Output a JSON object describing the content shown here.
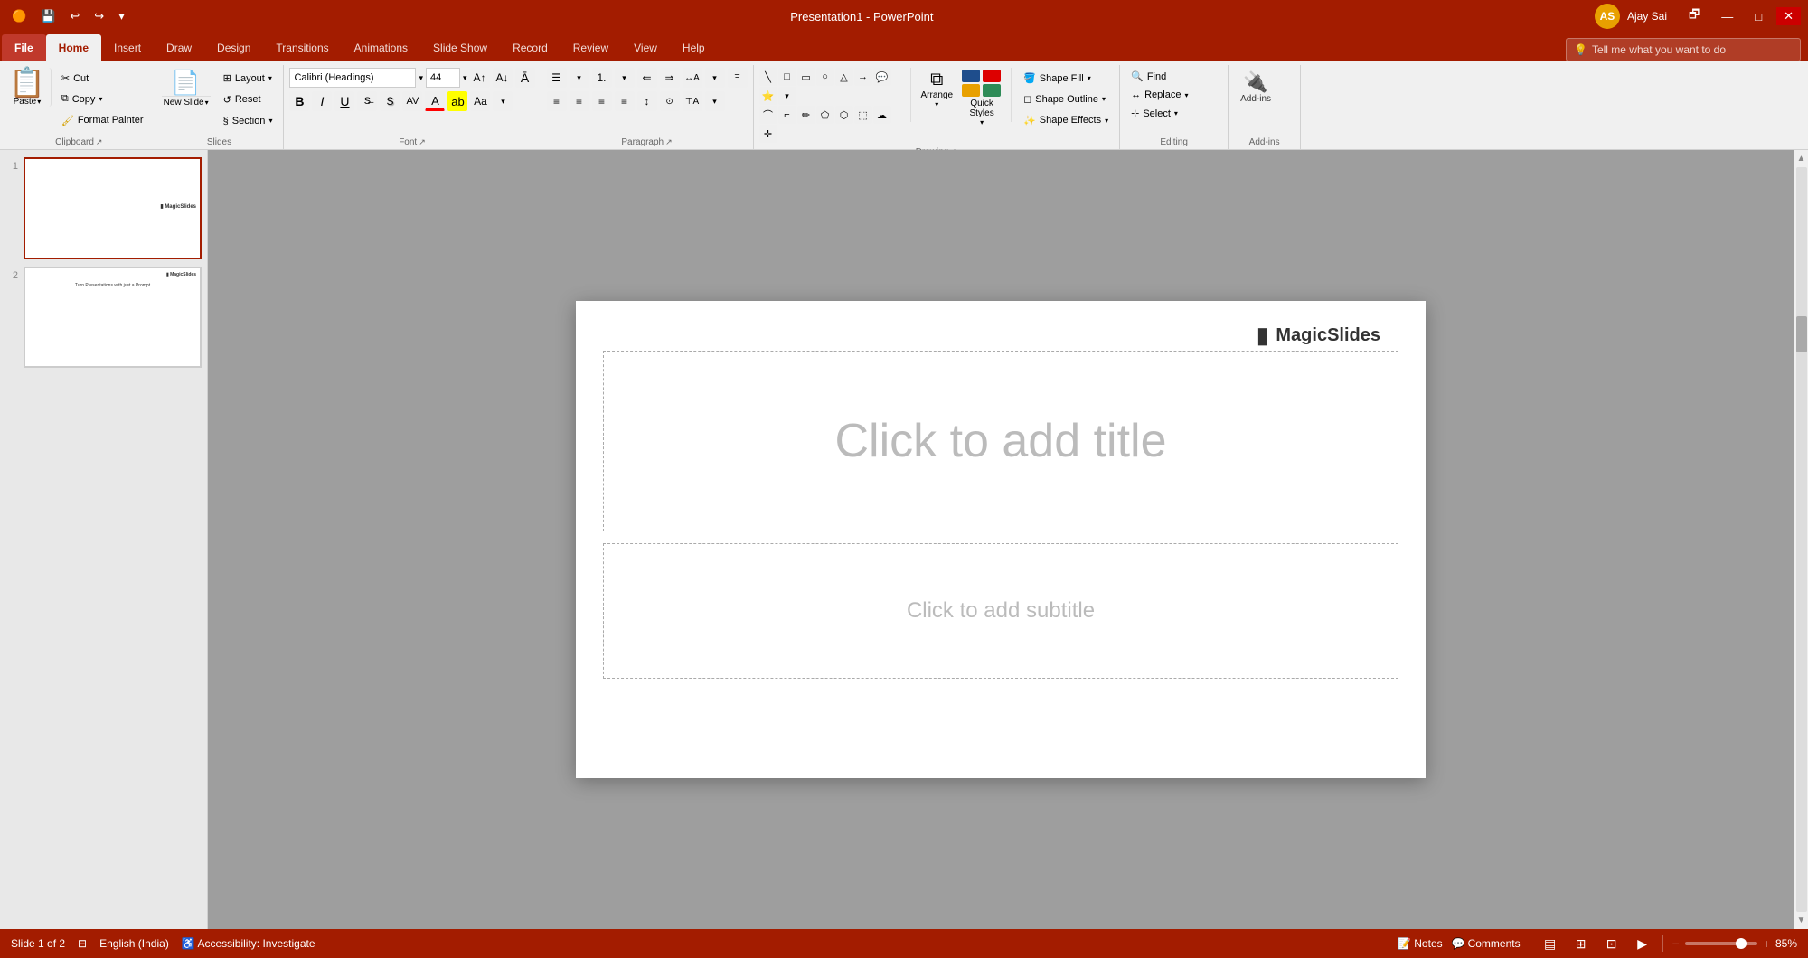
{
  "title_bar": {
    "title": "Presentation1  -  PowerPoint",
    "user": "Ajay Sai",
    "user_initials": "AS",
    "qat": [
      "save",
      "undo",
      "redo",
      "customize"
    ]
  },
  "ribbon_tabs": {
    "file": "File",
    "home": "Home",
    "insert": "Insert",
    "draw": "Draw",
    "design": "Design",
    "transitions": "Transitions",
    "animations": "Animations",
    "slide_show": "Slide Show",
    "record": "Record",
    "review": "Review",
    "view": "View",
    "help": "Help"
  },
  "ribbon": {
    "clipboard": {
      "label": "Clipboard",
      "paste": "Paste",
      "cut": "Cut",
      "copy": "Copy",
      "format_painter": "Format Painter"
    },
    "slides": {
      "label": "Slides",
      "new_slide": "New\nSlide",
      "layout": "Layout",
      "reset": "Reset",
      "section": "Section"
    },
    "font": {
      "label": "Font",
      "font_name": "Calibri (Headings)",
      "font_size": "44",
      "bold": "B",
      "italic": "I",
      "underline": "U",
      "strikethrough": "S",
      "shadow": "S",
      "increase_size": "A↑",
      "decrease_size": "A↓",
      "clear_format": "A",
      "font_color": "A"
    },
    "paragraph": {
      "label": "Paragraph"
    },
    "drawing": {
      "label": "Drawing",
      "arrange": "Arrange",
      "quick_styles": "Quick\nStyles",
      "shape_fill": "Shape Fill",
      "shape_outline": "Shape Outline",
      "shape_effects": "Shape Effects"
    },
    "editing": {
      "label": "Editing",
      "find": "Find",
      "replace": "Replace",
      "select": "Select"
    },
    "addins": {
      "label": "Add-ins",
      "add_ins": "Add-ins"
    }
  },
  "tell_me": {
    "placeholder": "Tell me what you want to do",
    "icon": "💡"
  },
  "slides": [
    {
      "number": "1",
      "active": true,
      "has_logo": true
    },
    {
      "number": "2",
      "active": false,
      "has_content": true,
      "title": "Turn Presentations with just a Prompt"
    }
  ],
  "canvas": {
    "title_placeholder": "Click to add title",
    "subtitle_placeholder": "Click to add subtitle",
    "logo_text": "MagicSlides"
  },
  "status_bar": {
    "slide_info": "Slide 1 of 2",
    "language": "English (India)",
    "accessibility": "Accessibility: Investigate",
    "notes": "Notes",
    "comments": "Comments",
    "zoom": "85%"
  }
}
